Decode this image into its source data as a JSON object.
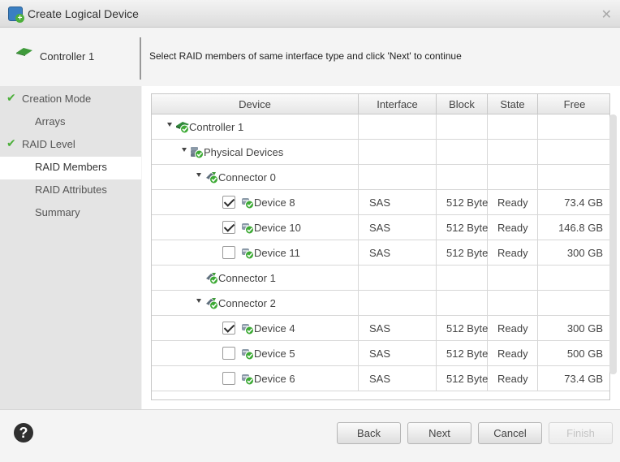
{
  "window": {
    "title": "Create Logical Device",
    "close_glyph": "✕"
  },
  "header": {
    "controller_label": "Controller 1",
    "instruction": "Select RAID members of same interface type and click 'Next' to continue"
  },
  "sidebar": {
    "items": [
      {
        "label": "Creation Mode",
        "done": true
      },
      {
        "label": "Arrays",
        "done": false
      },
      {
        "label": "RAID Level",
        "done": true
      },
      {
        "label": "RAID Members",
        "active": true
      },
      {
        "label": "RAID Attributes",
        "done": false
      },
      {
        "label": "Summary",
        "done": false
      }
    ]
  },
  "table": {
    "columns": [
      "Device",
      "Interface",
      "Block",
      "State",
      "Free"
    ],
    "rows": [
      {
        "name": "Controller 1",
        "level": 0,
        "expanded": true,
        "icon": "controller-icon"
      },
      {
        "name": "Physical Devices",
        "level": 1,
        "expanded": true,
        "icon": "physical-devices-icon"
      },
      {
        "name": "Connector 0",
        "level": 2,
        "expanded": true,
        "icon": "connector-icon"
      },
      {
        "name": "Device 8",
        "level": 3,
        "checked": true,
        "icon": "disk-icon",
        "interface": "SAS",
        "block": "512 Byte",
        "state": "Ready",
        "free": "73.4 GB"
      },
      {
        "name": "Device 10",
        "level": 3,
        "checked": true,
        "icon": "disk-icon",
        "interface": "SAS",
        "block": "512 Byte",
        "state": "Ready",
        "free": "146.8 GB"
      },
      {
        "name": "Device 11",
        "level": 3,
        "checked": false,
        "icon": "disk-icon",
        "interface": "SAS",
        "block": "512 Byte",
        "state": "Ready",
        "free": "300 GB"
      },
      {
        "name": "Connector 1",
        "level": 2,
        "expanded": false,
        "icon": "connector-icon"
      },
      {
        "name": "Connector 2",
        "level": 2,
        "expanded": true,
        "icon": "connector-icon"
      },
      {
        "name": "Device 4",
        "level": 3,
        "checked": true,
        "icon": "disk-icon",
        "interface": "SAS",
        "block": "512 Byte",
        "state": "Ready",
        "free": "300 GB"
      },
      {
        "name": "Device 5",
        "level": 3,
        "checked": false,
        "icon": "disk-icon",
        "interface": "SAS",
        "block": "512 Byte",
        "state": "Ready",
        "free": "500 GB"
      },
      {
        "name": "Device 6",
        "level": 3,
        "checked": false,
        "icon": "disk-icon",
        "interface": "SAS",
        "block": "512 Byte",
        "state": "Ready",
        "free": "73.4 GB"
      }
    ]
  },
  "footer": {
    "help_glyph": "?",
    "back_label": "Back",
    "next_label": "Next",
    "cancel_label": "Cancel",
    "finish_label": "Finish",
    "finish_enabled": false
  },
  "colors": {
    "check_green": "#4caf3a",
    "status_green": "#3daa35",
    "sidebar_bg": "#e4e4e4",
    "title_icon_blue": "#3a7fc2"
  }
}
